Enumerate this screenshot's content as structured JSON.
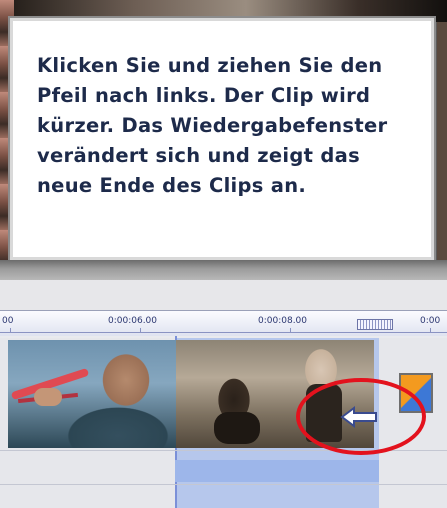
{
  "callout": {
    "lines": [
      "Klicken Sie und ziehen Sie den",
      "Pfeil nach links. Der Clip wird",
      "kürzer. Das Wiedergabefenster",
      "verändert sich und zeigt das",
      "neue Ende des Clips an."
    ]
  },
  "timeline": {
    "ticks": [
      "00",
      "0:00:06.00",
      "0:00:08.00",
      "0:00"
    ]
  },
  "icons": {
    "trim_arrow": "left-arrow-icon",
    "highlight": "red-circle-highlight",
    "transition": "transition-icon"
  },
  "colors": {
    "highlight": "#e3121d",
    "callout_text": "#1d2a4a",
    "selection": "#b6c7ec"
  }
}
